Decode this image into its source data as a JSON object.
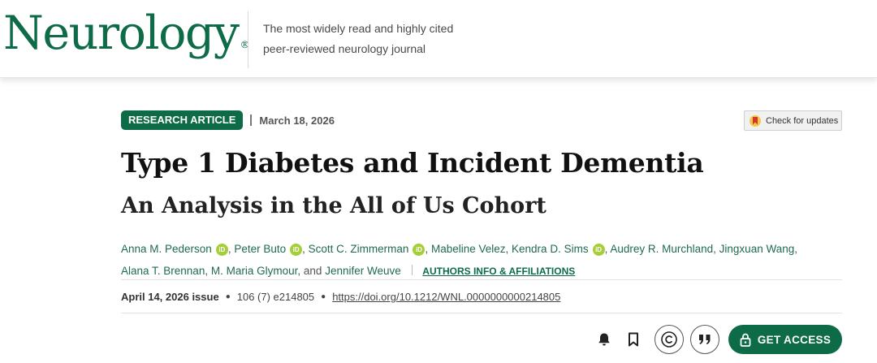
{
  "header": {
    "logo": "Neurology",
    "logo_mark": "®",
    "tagline_line1": "The most widely read and highly cited",
    "tagline_line2": "peer-reviewed neurology journal"
  },
  "article": {
    "badge": "RESEARCH ARTICLE",
    "date": "March 18, 2026",
    "check_updates": "Check for updates",
    "title": "Type 1 Diabetes and Incident Dementia",
    "subtitle": "An Analysis in the All of Us Cohort",
    "authors": [
      "Anna M. Pederson",
      "Peter Buto",
      "Scott C. Zimmerman",
      "Mabeline Velez",
      "Kendra D. Sims",
      "Audrey R. Murchland",
      "Jingxuan Wang",
      "Alana T. Brennan",
      "M. Maria Glymour",
      "Jennifer Weuve"
    ],
    "orcid_label": "iD",
    "and_word": "and",
    "affiliations_link": "AUTHORS INFO & AFFILIATIONS",
    "issue": "April 14, 2026 issue",
    "volume": "106 (7) e214805",
    "doi": "https://doi.org/10.1212/WNL.0000000000214805"
  },
  "actions": {
    "icons": [
      "bell-icon",
      "bookmark-icon",
      "copyright-icon",
      "quote-icon",
      "lock-icon"
    ],
    "get_access": "GET ACCESS"
  },
  "colors": {
    "brand_green": "#0e6b47",
    "author_green": "#1f6c4d",
    "orcid_green": "#a6ce39"
  }
}
